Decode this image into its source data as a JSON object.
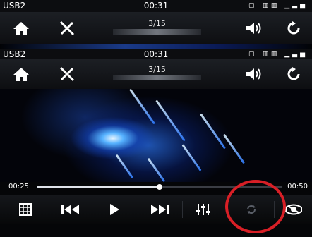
{
  "status": {
    "source": "USB2",
    "clock": "00:31"
  },
  "track": {
    "counter": "3/15"
  },
  "playback": {
    "elapsed": "00:25",
    "total": "00:50",
    "progress": 0.5
  },
  "colors": {
    "accent": "#d81f26",
    "bar": "#0d0e11"
  },
  "icons": {
    "home": "home-icon",
    "tools": "tools-icon",
    "volume": "volume-icon",
    "back": "back-icon",
    "grid": "grid-icon",
    "prev": "previous-icon",
    "play": "play-icon",
    "next": "next-icon",
    "eq": "equalizer-icon",
    "repeat": "repeat-icon",
    "display": "display-icon"
  }
}
